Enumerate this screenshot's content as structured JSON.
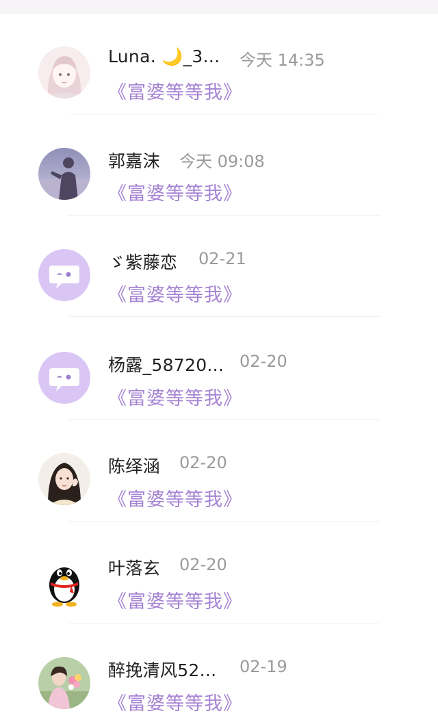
{
  "conversations": [
    {
      "name": "Luna. 🌙_3...",
      "time": "今天 14:35",
      "message": "《富婆等等我》",
      "avatar_icon": "anime-girl-avatar-icon"
    },
    {
      "name": "郭嘉沫",
      "time": "今天 09:08",
      "message": "《富婆等等我》",
      "avatar_icon": "silhouette-photo-avatar-icon"
    },
    {
      "name": "ゞ紫藤恋",
      "time": "02-21",
      "message": "《富婆等等我》",
      "avatar_icon": "default-chat-bubble-avatar-icon"
    },
    {
      "name": "杨露_58720...",
      "time": "02-20",
      "message": "《富婆等等我》",
      "avatar_icon": "default-chat-bubble-avatar-icon"
    },
    {
      "name": "陈绎涵",
      "time": "02-20",
      "message": "《富婆等等我》",
      "avatar_icon": "girl-photo-avatar-icon"
    },
    {
      "name": "叶落玄",
      "time": "02-20",
      "message": "《富婆等等我》",
      "avatar_icon": "qq-penguin-avatar-icon"
    },
    {
      "name": "醉挽清风52...",
      "time": "02-19",
      "message": "《富婆等等我》",
      "avatar_icon": "flower-girl-photo-avatar-icon"
    }
  ],
  "colors": {
    "message_text": "#a684d3",
    "default_avatar_bg": "#d9c6f5",
    "name_text": "#222222",
    "time_text": "#9a9a9a"
  }
}
